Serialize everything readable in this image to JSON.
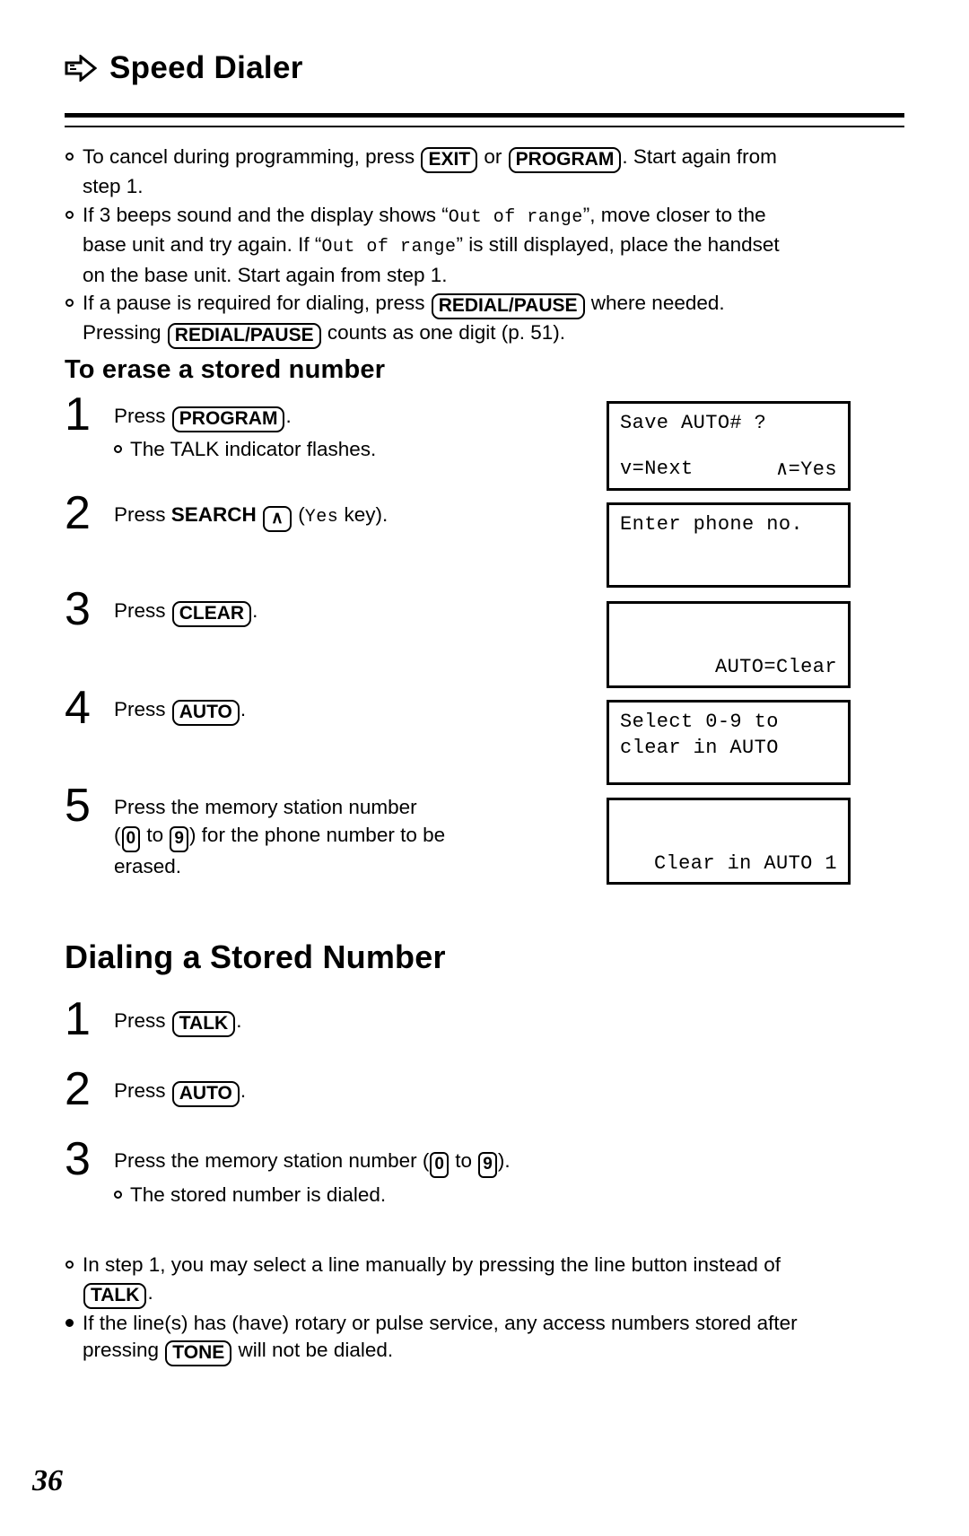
{
  "header": {
    "title": "Speed Dialer",
    "arrow_icon": "right-arrow-icon"
  },
  "top_notes": [
    {
      "line1_a": "To cancel during programming, press ",
      "key1": "EXIT",
      "line1_b": " or ",
      "key2": "PROGRAM",
      "line1_c": ". Start again from",
      "line2": "step 1."
    },
    {
      "line1_a": "If 3 beeps sound and the display shows “",
      "mono1": "Out of range",
      "line1_b": "”, move closer to the",
      "line2_a": "base unit and try again. If “",
      "mono2": "Out of range",
      "line2_b": "” is still displayed, place the handset",
      "line3": "on the base unit. Start again from step 1."
    },
    {
      "line1_a": "If a pause is required for dialing, press ",
      "key1": "REDIAL/PAUSE",
      "line1_b": " where needed.",
      "line2_a": "Pressing ",
      "key2": "REDIAL/PAUSE",
      "line2_b": " counts as one digit (p. 51)."
    }
  ],
  "erase_section": {
    "heading": "To erase a stored number",
    "steps": [
      {
        "number": "1",
        "text_a": "Press ",
        "key": "PROGRAM",
        "text_b": ".",
        "subbullet": "The TALK indicator flashes."
      },
      {
        "number": "2",
        "text_a": "Press ",
        "strong": "SEARCH",
        "key": "∧",
        "text_b": " (",
        "mono": "Yes",
        "text_c": " key)."
      },
      {
        "number": "3",
        "text_a": "Press ",
        "key": "CLEAR",
        "text_b": "."
      },
      {
        "number": "4",
        "text_a": "Press ",
        "key": "AUTO",
        "text_b": "."
      },
      {
        "number": "5",
        "line1": "Press the memory station number",
        "line2_a": "(",
        "key_from": "0",
        "line2_b": " to ",
        "key_to": "9",
        "line2_c": ") for the phone number to be",
        "line3": "erased."
      }
    ],
    "displays": [
      {
        "top": "Save AUTO# ?",
        "bottom_left": "v=Next",
        "bottom_right": "∧=Yes"
      },
      {
        "top": "Enter phone no."
      },
      {
        "bottom_right": "AUTO=Clear"
      },
      {
        "top": "Select 0-9 to",
        "second": "clear in AUTO"
      },
      {
        "bottom_right": "Clear in AUTO 1"
      }
    ]
  },
  "dialing_section": {
    "heading": "Dialing a Stored Number",
    "steps": [
      {
        "number": "1",
        "text_a": "Press ",
        "key": "TALK",
        "text_b": "."
      },
      {
        "number": "2",
        "text_a": "Press ",
        "key": "AUTO",
        "text_b": "."
      },
      {
        "number": "3",
        "text_a": "Press the memory station number (",
        "key_from": "0",
        "text_b": " to ",
        "key_to": "9",
        "text_c": ").",
        "subbullet": "The stored number is dialed."
      }
    ]
  },
  "bottom_notes": [
    {
      "line1": "In step 1, you may select a line manually by pressing the line button instead of",
      "key": "TALK",
      "line2_tail": "."
    },
    {
      "line1": "If the line(s) has (have) rotary or pulse service, any access numbers stored after",
      "line2_a": "pressing ",
      "key": "TONE",
      "line2_b": " will not be dialed."
    }
  ],
  "page_number": "36"
}
